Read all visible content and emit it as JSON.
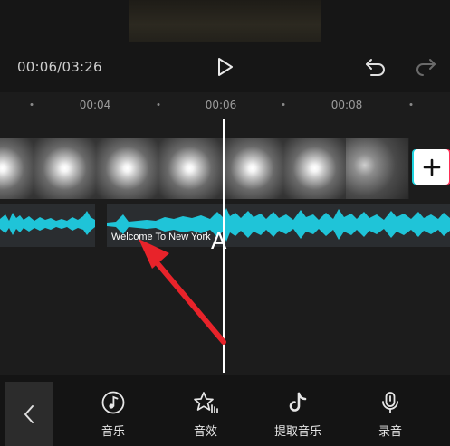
{
  "player": {
    "time_display": "00:06/03:26"
  },
  "ruler": {
    "ticks": [
      "00:04",
      "00:06",
      "00:08"
    ]
  },
  "audio": {
    "clip_title": "Welcome To New York",
    "waveform_color": "#1fc4d8"
  },
  "playhead": {
    "marker": "A"
  },
  "toolbar": {
    "items": [
      {
        "label": "音乐",
        "icon": "music-note-icon"
      },
      {
        "label": "音效",
        "icon": "star-sound-effect-icon"
      },
      {
        "label": "提取音乐",
        "icon": "tiktok-note-icon"
      },
      {
        "label": "录音",
        "icon": "microphone-icon"
      }
    ]
  },
  "colors": {
    "accent_cyan": "#1fc4d8",
    "annotation_arrow": "#e8232a",
    "background": "#161616"
  }
}
